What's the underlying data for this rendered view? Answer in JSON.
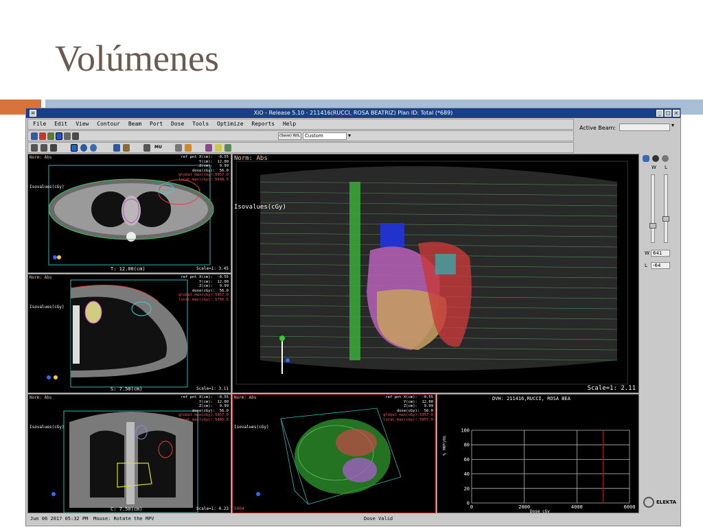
{
  "slide": {
    "title": "Volúmenes"
  },
  "window": {
    "title": "XiO - Release 5.10 - 211416(RUCCI, ROSA BEATRIZ) Plan ID: Total (*689)",
    "menu": [
      "File",
      "Edit",
      "View",
      "Contour",
      "Beam",
      "Port",
      "Dose",
      "Tools",
      "Optimize",
      "Reports",
      "Help"
    ],
    "save_wl_label": "(Save) W/L",
    "wl_preset": "Custom",
    "active_beam_label": "Active Beam:",
    "active_beam_value": "",
    "mu_label": "MU",
    "w_label": "W",
    "l_label": "L",
    "w_value": "641",
    "l_value": "-64",
    "vendor": "ELEKTA"
  },
  "views": {
    "transverse": {
      "norm": "Norm: Abs",
      "iso": "Isovalues(cGy)",
      "info_white": "ref pnt X(cm):  -0.55\nY(cm):  12.00\nZ(cm):   9.99\ndose(cGy):  56.0",
      "info_red": "global max(cGy):5957.0\nlocal max(cGy): 5848.5",
      "slice": "T:  12.00(cm)",
      "scale": "Scale=1: 3.45"
    },
    "sagittal": {
      "norm": "Norm: Abs",
      "iso": "Isovalues(cGy)",
      "info_white": "ref pnt X(cm):  -0.55\nY(cm):  12.00\nZ(cm):   9.99\ndose(cGy):  56.0",
      "info_red": "global max(cGy):5957.0\nlocal max(cGy): 5756.5",
      "slice": "S:   7.50(cm)",
      "scale": "Scale=1: 3.11"
    },
    "coronal": {
      "norm": "Norm: Abs",
      "iso": "Isovalues(cGy)",
      "info_white": "ref pnt X(cm):  -0.55\nY(cm):  12.00\nZ(cm):   9.99\ndose(cGy):  56.0",
      "info_red": "global max(cGy):5957.0\nlocal max(cGy): 5405.5",
      "slice": "C:   7.50(cm)",
      "scale": "Scale=1: 4.23"
    },
    "render3d": {
      "norm": "Norm: Abs",
      "iso": "Isovalues(cGy)",
      "scale": "Scale=1: 2.11"
    },
    "mpv": {
      "norm": "Norm: Abs",
      "iso": "Isovalues(cGy)",
      "info_white": "ref pnt X(cm):  -0.55\nY(cm):  12.00\nZ(cm):   9.99\ndose(cGy):  56.0",
      "info_red": "global max(cGy):5957.0\nlocal max(cGy): 5957.0",
      "corner": "5004"
    }
  },
  "status": {
    "datetime": "Jun 06 2017 05:32 PM",
    "mouse": "Mouse:  Rotate the MPV",
    "dose": "Dose Valid"
  },
  "chart_data": {
    "type": "line",
    "title": "DVH: 211416,RUCCI, ROSA BEA",
    "xlabel": "Dose cGy",
    "ylabel": "Volume %",
    "xlim": [
      0,
      6000
    ],
    "ylim": [
      0,
      100
    ],
    "x_ticks": [
      0,
      2000,
      4000,
      6000
    ],
    "y_ticks": [
      0,
      20,
      40,
      60,
      80,
      100
    ],
    "grid": true,
    "series": [
      {
        "x": [
          5000,
          5000
        ],
        "values": [
          0,
          100
        ],
        "color": "#a02020"
      }
    ]
  }
}
